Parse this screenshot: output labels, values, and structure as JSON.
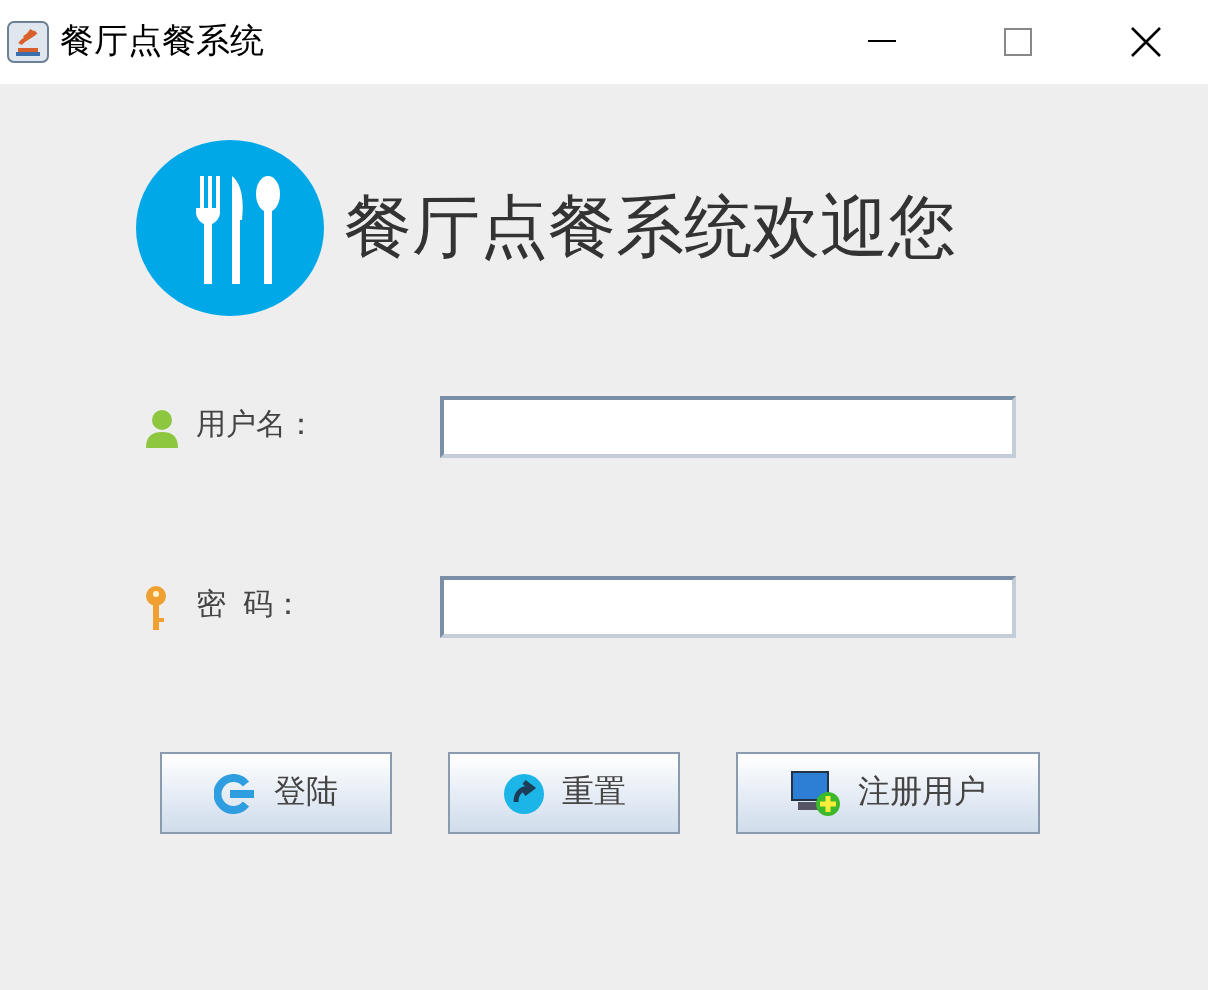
{
  "window": {
    "title": "餐厅点餐系统"
  },
  "heading": "餐厅点餐系统欢迎您",
  "fields": [
    {
      "kind": "user",
      "label": "用户名："
    },
    {
      "kind": "password",
      "label": "密  码："
    }
  ],
  "buttons": [
    {
      "kind": "login",
      "label": "登陆"
    },
    {
      "kind": "reset",
      "label": "重置"
    },
    {
      "kind": "register",
      "label": "注册用户"
    }
  ]
}
